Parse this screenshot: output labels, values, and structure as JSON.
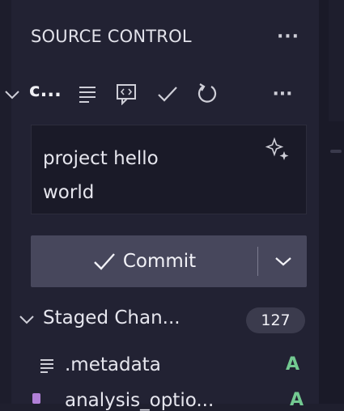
{
  "header": {
    "title": "SOURCE CONTROL",
    "more_label": "···"
  },
  "repo": {
    "name": "c...",
    "toolbar_icons": [
      "view-as-list-icon",
      "compare-icon",
      "check-icon",
      "refresh-icon",
      "more-icon"
    ],
    "more_label": "···"
  },
  "commit_message": {
    "value": "project hello\nworld",
    "icon": "sparkle-icon"
  },
  "commit_button": {
    "label": "Commit",
    "dropdown_icon": "chevron-down-icon"
  },
  "staged": {
    "label": "Staged Chan...",
    "count": "127",
    "files": [
      {
        "name": ".metadata",
        "status": "A",
        "icon": "lines-file-icon"
      },
      {
        "name": "analysis_optio...",
        "status": "A",
        "icon": "file-icon"
      }
    ]
  },
  "colors": {
    "added_status": "#73c991",
    "commit_button_bg": "#47475c",
    "panel_bg": "#222233"
  }
}
